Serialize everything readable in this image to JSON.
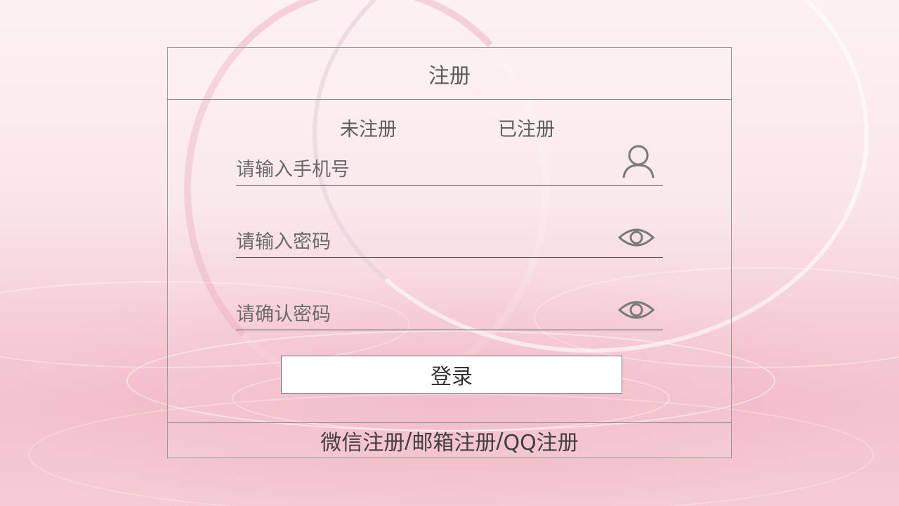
{
  "header": {
    "title": "注册"
  },
  "tabs": [
    {
      "label": "未注册"
    },
    {
      "label": "已注册"
    }
  ],
  "fields": {
    "phone": {
      "placeholder": "请输入手机号",
      "icon": "user-icon"
    },
    "password": {
      "placeholder": "请输入密码",
      "icon": "eye-icon"
    },
    "confirm_password": {
      "placeholder": "请确认密码",
      "icon": "eye-icon"
    }
  },
  "login_button": {
    "label": "登录"
  },
  "footer": {
    "wechat": "微信注册",
    "separator1": "/",
    "email": "邮箱注册",
    "separator2": "/",
    "qq": "QQ注册"
  },
  "colors": {
    "background_top": "#fdf1f3",
    "background_bottom": "#f3c2cd",
    "panel_border": "#9a9a9a",
    "text": "#5e5e5e",
    "button_bg": "#ffffff"
  }
}
